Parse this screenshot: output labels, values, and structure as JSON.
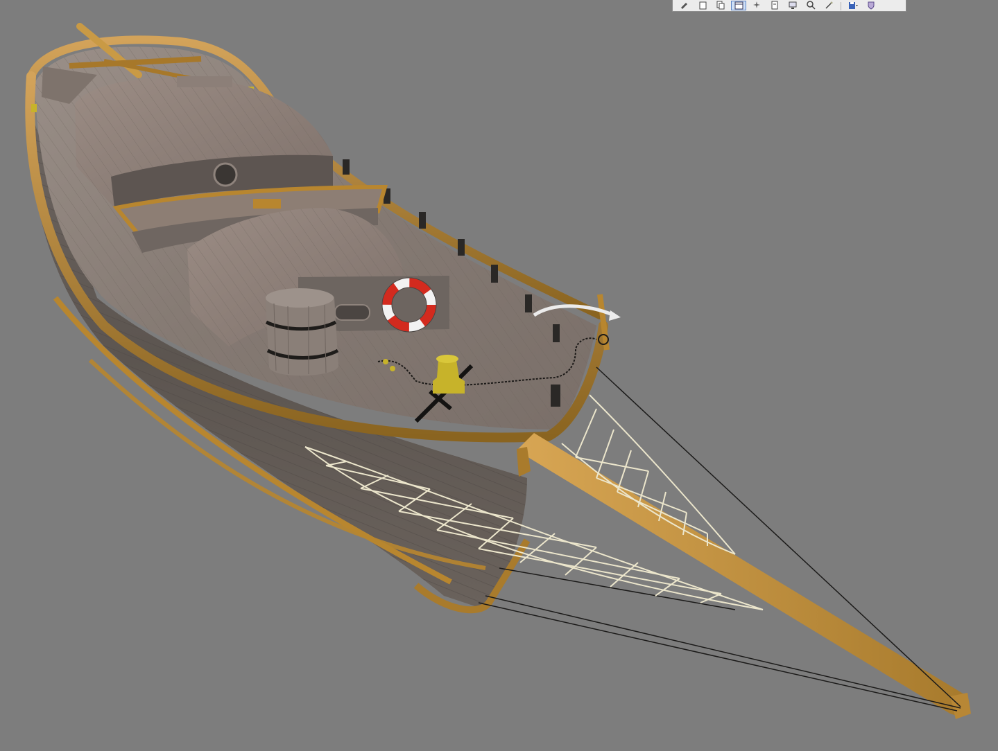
{
  "viewport": {
    "background": "#7d7d7d",
    "model": "wooden-sailboat"
  },
  "toolbar": {
    "buttons": [
      {
        "name": "pencil-icon",
        "active": false
      },
      {
        "name": "page-icon",
        "active": false
      },
      {
        "name": "copy-icon",
        "active": false
      },
      {
        "name": "frame-select-icon",
        "active": true
      },
      {
        "name": "star-burst-icon",
        "active": false
      },
      {
        "name": "document-icon",
        "active": false
      },
      {
        "name": "monitor-icon",
        "active": false
      },
      {
        "name": "zoom-icon",
        "active": false
      },
      {
        "name": "wand-icon",
        "active": false
      },
      {
        "name": "save-dropdown-icon",
        "active": false
      },
      {
        "name": "shield-icon",
        "active": false
      }
    ]
  },
  "colors": {
    "deck": "#8a7f78",
    "hull": "#6f6660",
    "rail": "#b8862f",
    "bowsprit": "#c99a45",
    "lifebuoy_red": "#d32a1e",
    "lifebuoy_white": "#f2f2f2",
    "bollard": "#c7b32a",
    "net": "#ece6cc"
  }
}
